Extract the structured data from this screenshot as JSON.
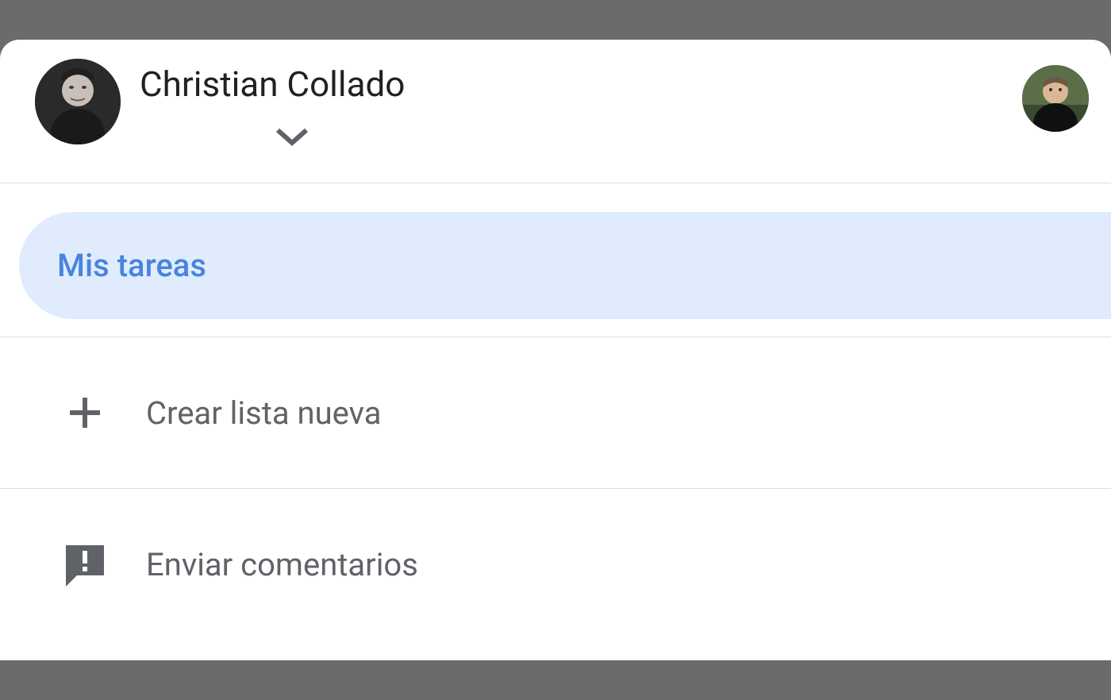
{
  "header": {
    "user_name": "Christian Collado"
  },
  "lists": {
    "selected": "Mis tareas"
  },
  "menu": {
    "create_list": "Crear lista nueva",
    "send_feedback": "Enviar comentarios"
  }
}
